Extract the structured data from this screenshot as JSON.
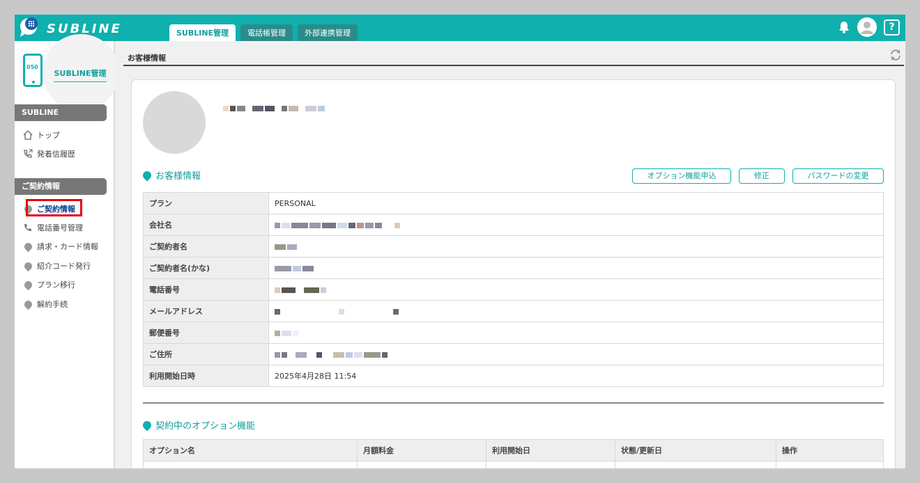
{
  "app": {
    "brand": "SUBLINE"
  },
  "header": {
    "tabs": [
      {
        "label": "SUBLINE管理",
        "active": true
      },
      {
        "label": "電話帳管理",
        "active": false
      },
      {
        "label": "外部連携管理",
        "active": false
      }
    ],
    "help_label": "?"
  },
  "sidebar": {
    "phone_number_prefix": "050",
    "title": "SUBLINE管理",
    "section1": "SUBLINE",
    "items1": [
      {
        "label": "トップ",
        "icon": "home-icon"
      },
      {
        "label": "発着信履歴",
        "icon": "call-history-icon"
      }
    ],
    "section2": "ご契約情報",
    "items2": [
      {
        "label": "ご契約情報",
        "icon": "pin-icon",
        "active": true
      },
      {
        "label": "電話番号管理",
        "icon": "phone-icon"
      },
      {
        "label": "請求・カード情報",
        "icon": "pin-icon"
      },
      {
        "label": "紹介コード発行",
        "icon": "pin-icon"
      },
      {
        "label": "プラン移行",
        "icon": "pin-icon"
      },
      {
        "label": "解約手続",
        "icon": "pin-icon"
      }
    ]
  },
  "page": {
    "title": "お客様情報",
    "customer_section_title": "お客様情報",
    "buttons": {
      "option_apply": "オプション機能申込",
      "edit": "修正",
      "change_password": "パスワードの変更"
    },
    "info_rows": [
      {
        "label": "プラン",
        "value": "PERSONAL"
      },
      {
        "label": "会社名",
        "value": ""
      },
      {
        "label": "ご契約者名",
        "value": ""
      },
      {
        "label": "ご契約者名(かな)",
        "value": ""
      },
      {
        "label": "電話番号",
        "value": ""
      },
      {
        "label": "メールアドレス",
        "value": ""
      },
      {
        "label": "郵便番号",
        "value": ""
      },
      {
        "label": "ご住所",
        "value": ""
      },
      {
        "label": "利用開始日時",
        "value": "2025年4月28日 11:54"
      }
    ],
    "options_section_title": "契約中のオプション機能",
    "options_headers": [
      "オプション名",
      "月額料金",
      "利用開始日",
      "状態/更新日",
      "操作"
    ]
  },
  "colors": {
    "accent": "#0fb0ad",
    "highlight": "#e60012"
  }
}
